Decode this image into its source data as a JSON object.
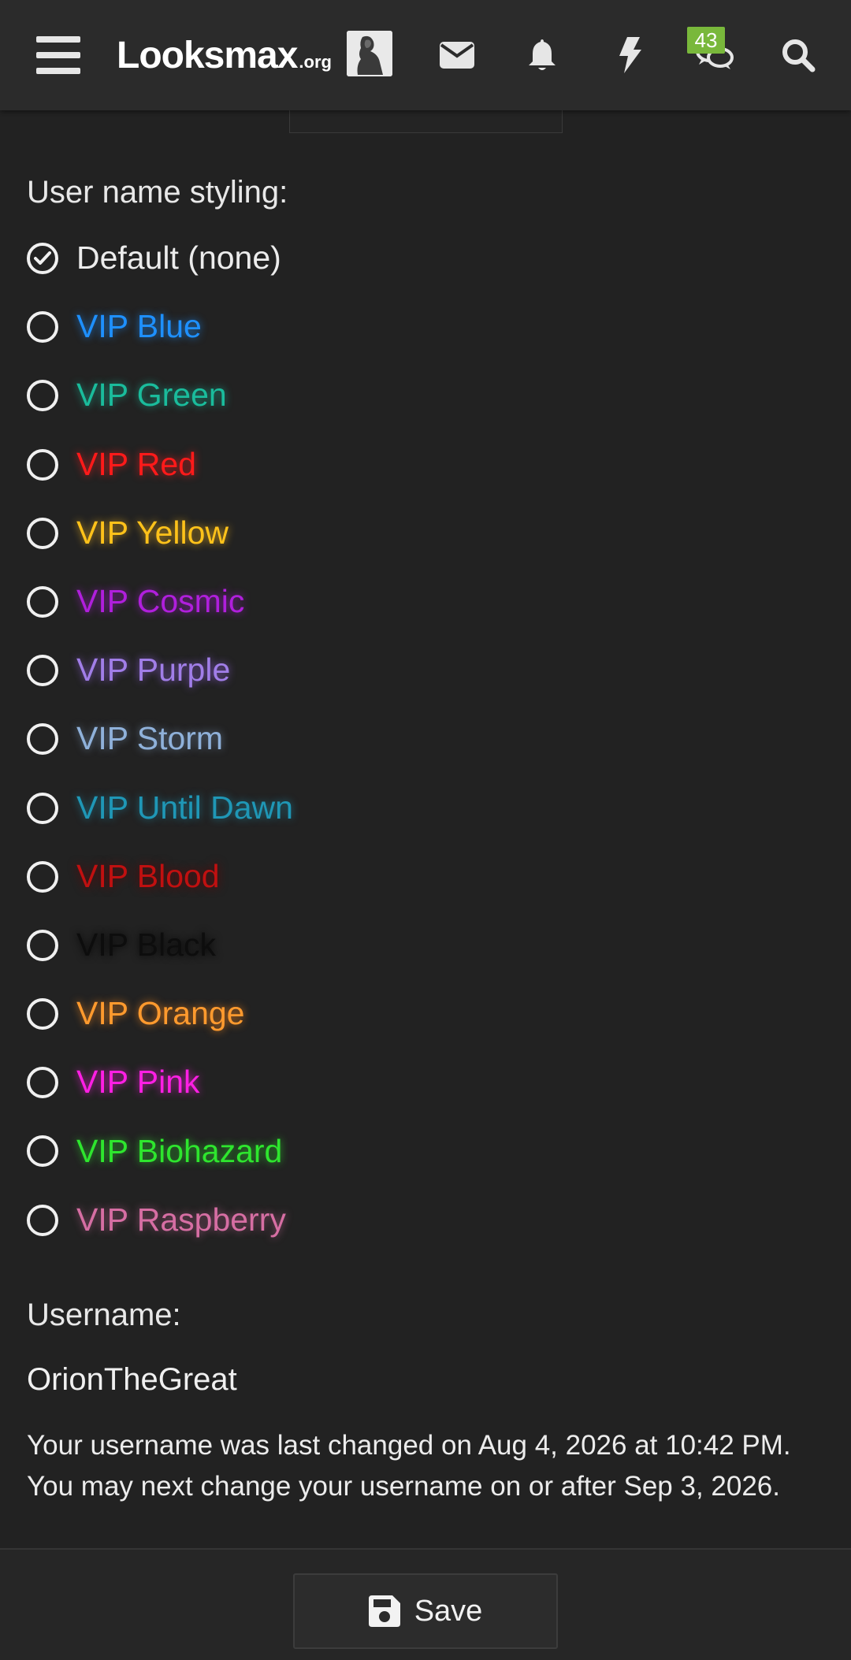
{
  "header": {
    "logo_main": "Looksmax",
    "logo_tld": ".org",
    "notification_count": "43",
    "icons": [
      "menu-icon",
      "mail-icon",
      "bell-icon",
      "bolt-icon",
      "chat-icon",
      "search-icon"
    ]
  },
  "styling": {
    "label": "User name styling:",
    "options": [
      {
        "label": "Default (none)",
        "color": "#ececec",
        "glow": "none",
        "checked": true
      },
      {
        "label": "VIP Blue",
        "color": "#1e90ff",
        "glow": "0 0 10px rgba(30,144,255,0.8)",
        "checked": false
      },
      {
        "label": "VIP Green",
        "color": "#1abc9c",
        "glow": "0 0 10px rgba(26,188,156,0.75)",
        "checked": false
      },
      {
        "label": "VIP Red",
        "color": "#ff1a1a",
        "glow": "0 0 10px rgba(255,30,30,0.8)",
        "checked": false
      },
      {
        "label": "VIP Yellow",
        "color": "#ffc21a",
        "glow": "0 0 10px rgba(255,190,30,0.8)",
        "checked": false
      },
      {
        "label": "VIP Cosmic",
        "color": "#b01fdc",
        "glow": "0 0 10px rgba(176,31,220,0.75)",
        "checked": false
      },
      {
        "label": "VIP Purple",
        "color": "#a17ee8",
        "glow": "0 0 10px rgba(150,100,230,0.8)",
        "checked": false
      },
      {
        "label": "VIP Storm",
        "color": "#8fb1da",
        "glow": "0 0 10px rgba(143,177,218,0.6)",
        "checked": false
      },
      {
        "label": "VIP Until Dawn",
        "color": "#1f97b6",
        "glow": "0 0 10px rgba(31,151,182,0.7)",
        "checked": false
      },
      {
        "label": "VIP Blood",
        "color": "#c01010",
        "glow": "0 0 12px rgba(110,0,0,0.9)",
        "checked": false
      },
      {
        "label": "VIP Black",
        "color": "#0d0d0d",
        "glow": "0 0 10px rgba(0,0,0,0.9)",
        "checked": false
      },
      {
        "label": "VIP Orange",
        "color": "#ff9a2e",
        "glow": "0 0 10px rgba(255,140,30,0.8)",
        "checked": false
      },
      {
        "label": "VIP Pink",
        "color": "#ff1fe4",
        "glow": "0 0 10px rgba(255,31,228,0.8)",
        "checked": false
      },
      {
        "label": "VIP Biohazard",
        "color": "#2ee62e",
        "glow": "0 0 10px rgba(46,230,46,0.75)",
        "checked": false
      },
      {
        "label": "VIP Raspberry",
        "color": "#d66ea3",
        "glow": "0 0 10px rgba(214,110,163,0.6)",
        "checked": false
      }
    ]
  },
  "username": {
    "label": "Username:",
    "value": "OrionTheGreat",
    "hint_line1": "Your username was last changed on Aug 4, 2026 at 10:42 PM.",
    "hint_line2": "You may next change your username on or after Sep 3, 2026."
  },
  "footer": {
    "save_label": "Save"
  }
}
